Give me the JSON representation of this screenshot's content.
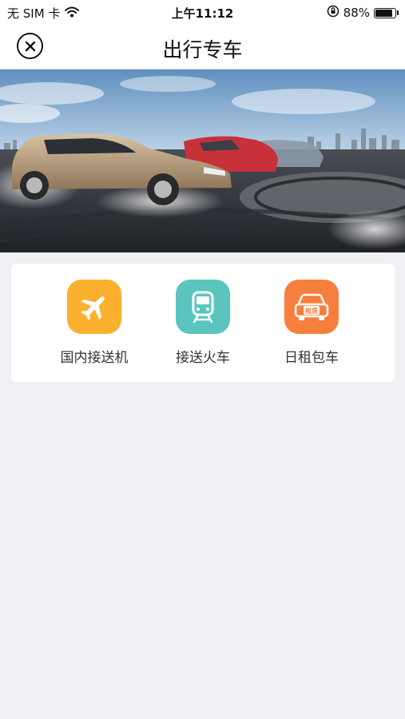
{
  "status_bar": {
    "carrier": "无 SIM 卡",
    "time": "上午11:12",
    "battery_percent": "88%",
    "battery_level": 0.88
  },
  "nav": {
    "title": "出行专车",
    "close_icon": "close-circle-icon"
  },
  "banner": {
    "description_icon": "car-banner-image"
  },
  "services": [
    {
      "label": "国内接送机",
      "icon": "airplane-icon",
      "color": "#fbb02d"
    },
    {
      "label": "接送火车",
      "icon": "train-icon",
      "color": "#5bc4be"
    },
    {
      "label": "日租包车",
      "icon": "rental-car-icon",
      "color": "#f77f3e",
      "badge": "租赁"
    }
  ],
  "colors": {
    "background": "#efeff4",
    "card": "#ffffff"
  }
}
